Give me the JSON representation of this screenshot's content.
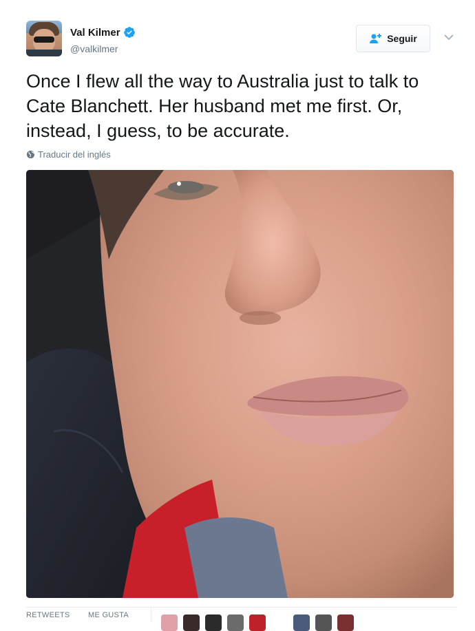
{
  "user": {
    "display_name": "Val Kilmer",
    "handle": "@valkilmer",
    "verified": true,
    "avatar_icon": "profile-photo"
  },
  "follow_button": {
    "label": "Seguir",
    "icon": "follow-user-plus-icon",
    "accent": "#1da1f2"
  },
  "menu": {
    "icon": "chevron-down-icon"
  },
  "tweet": {
    "text": "Once I flew all the way to Australia just to talk to Cate Blanchett. Her husband met me first. Or, instead, I guess, to be accurate.",
    "translate_label": "Traducir del inglés",
    "translate_icon": "globe-icon"
  },
  "media": {
    "type": "photo",
    "icon": "close-up-selfie-photo"
  },
  "stats": {
    "retweets_label": "RETWEETS",
    "likes_label": "ME GUSTA"
  },
  "likers": [
    {
      "color": "#e0a0a8"
    },
    {
      "color": "#3a2a2a"
    },
    {
      "color": "#2b2b2b"
    },
    {
      "color": "#6b6b6b"
    },
    {
      "color": "#c0202a"
    },
    {
      "color": "#4a5a7a"
    },
    {
      "color": "#555555"
    },
    {
      "color": "#7a3030"
    }
  ],
  "colors": {
    "text": "#14171a",
    "secondary": "#657786",
    "verified": "#1da1f2",
    "border": "#e1e8ed"
  }
}
